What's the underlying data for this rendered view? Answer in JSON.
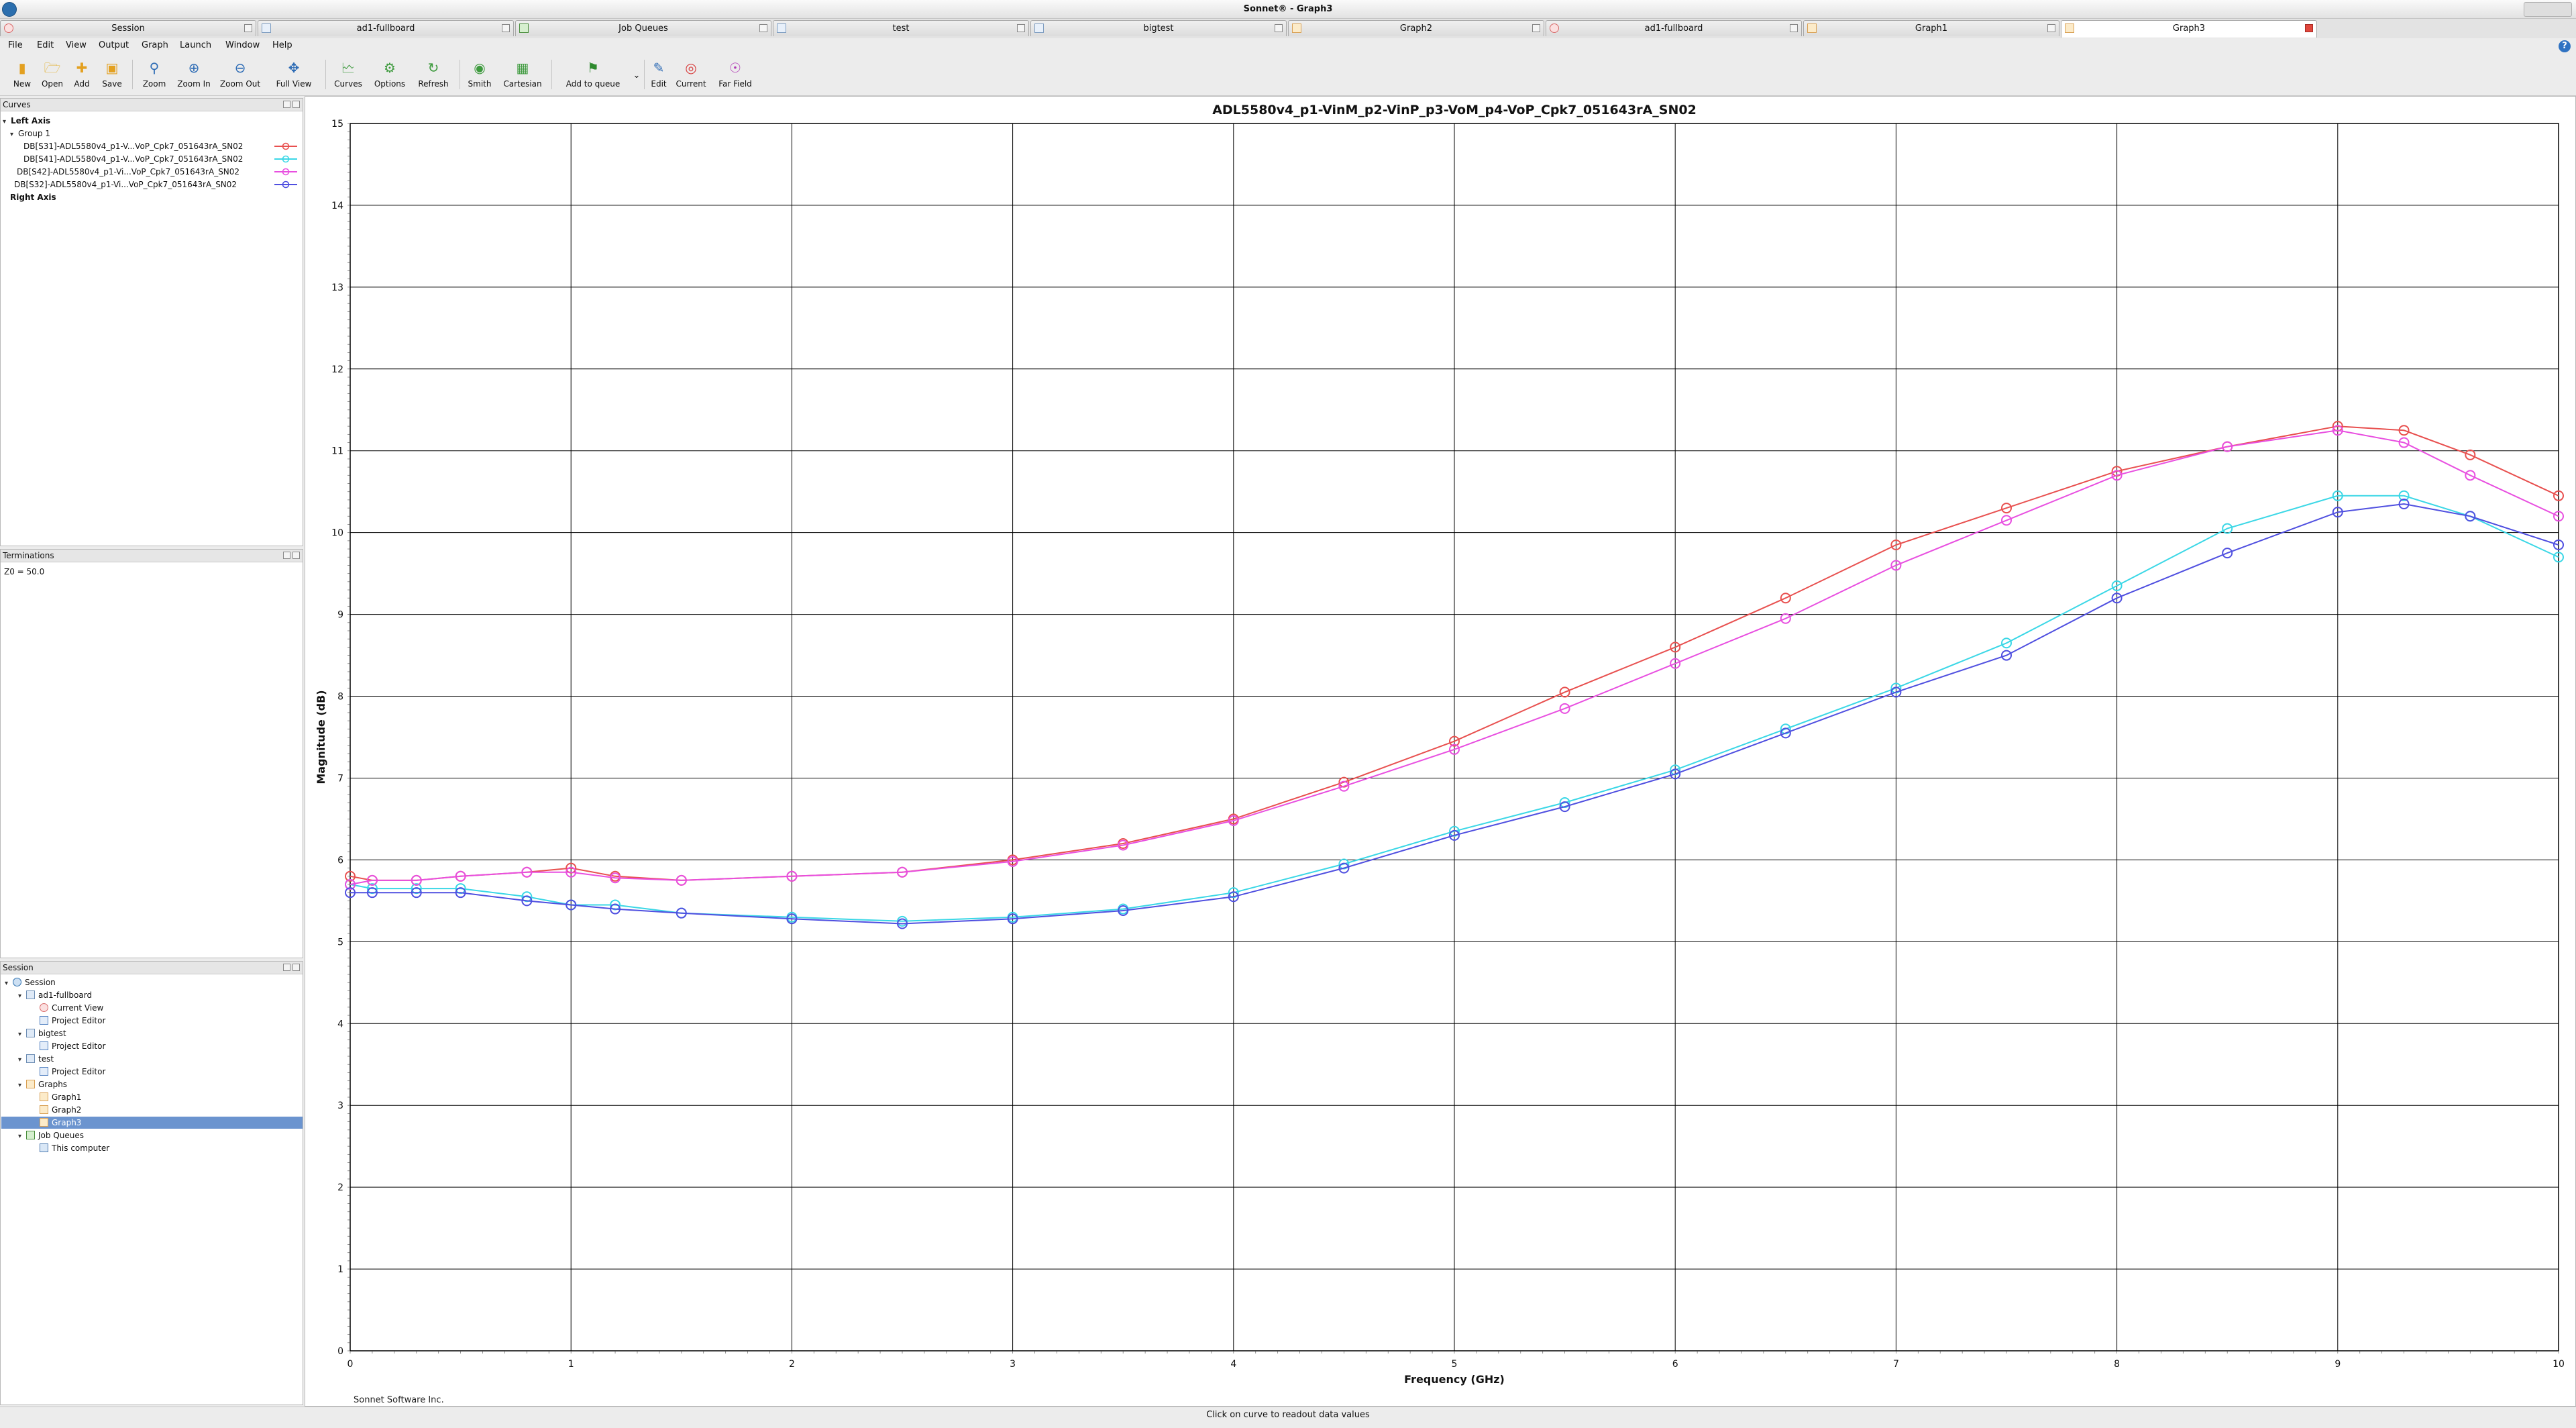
{
  "window": {
    "title": "Sonnet® - Graph3"
  },
  "tabs": [
    {
      "label": "Session",
      "icon": "session-icon",
      "active": false
    },
    {
      "label": "ad1-fullboard",
      "icon": "project-editor-icon",
      "active": false
    },
    {
      "label": "Job Queues",
      "icon": "job-queue-icon",
      "active": false
    },
    {
      "label": "test",
      "icon": "project-editor-icon",
      "active": false
    },
    {
      "label": "bigtest",
      "icon": "project-editor-icon",
      "active": false
    },
    {
      "label": "Graph2",
      "icon": "graph-icon",
      "active": false
    },
    {
      "label": "ad1-fullboard",
      "icon": "current-view-icon",
      "active": false
    },
    {
      "label": "Graph1",
      "icon": "graph-icon",
      "active": false
    },
    {
      "label": "Graph3",
      "icon": "graph-icon",
      "active": true
    }
  ],
  "menu": [
    "File",
    "Edit",
    "View",
    "Output",
    "Graph",
    "Launch",
    "Window",
    "Help"
  ],
  "toolbar": {
    "new": "New",
    "open": "Open",
    "add": "Add",
    "save": "Save",
    "zoom": "Zoom",
    "zoom_in": "Zoom In",
    "zoom_out": "Zoom Out",
    "full_view": "Full View",
    "curves": "Curves",
    "options": "Options",
    "refresh": "Refresh",
    "smith": "Smith",
    "cartesian": "Cartesian",
    "add_to_queue": "Add to queue",
    "edit": "Edit",
    "current": "Current",
    "far_field": "Far Field"
  },
  "curves_panel": {
    "title": "Curves",
    "left_axis": "Left Axis",
    "group": "Group 1",
    "items": [
      {
        "label": "DB[S31]-ADL5580v4_p1-V...VoP_Cpk7_051643rA_SN02",
        "color": "#e8504f"
      },
      {
        "label": "DB[S41]-ADL5580v4_p1-V...VoP_Cpk7_051643rA_SN02",
        "color": "#3ad7e6"
      },
      {
        "label": "DB[S42]-ADL5580v4_p1-Vi...VoP_Cpk7_051643rA_SN02",
        "color": "#e84fe0"
      },
      {
        "label": "DB[S32]-ADL5580v4_p1-Vi...VoP_Cpk7_051643rA_SN02",
        "color": "#4f4fe0"
      }
    ],
    "right_axis": "Right Axis"
  },
  "terminations_panel": {
    "title": "Terminations",
    "value": "Z0 = 50.0"
  },
  "session_panel": {
    "title": "Session",
    "tree": [
      {
        "label": "Session",
        "level": 0,
        "icon": "session-icon",
        "toggle": "expanded"
      },
      {
        "label": "ad1-fullboard",
        "level": 1,
        "icon": "project-icon",
        "toggle": "expanded"
      },
      {
        "label": "Current View",
        "level": 2,
        "icon": "current-view-icon"
      },
      {
        "label": "Project Editor",
        "level": 2,
        "icon": "project-editor-icon"
      },
      {
        "label": "bigtest",
        "level": 1,
        "icon": "project-icon",
        "toggle": "expanded"
      },
      {
        "label": "Project Editor",
        "level": 2,
        "icon": "project-editor-icon"
      },
      {
        "label": "test",
        "level": 1,
        "icon": "project-icon",
        "toggle": "expanded"
      },
      {
        "label": "Project Editor",
        "level": 2,
        "icon": "project-editor-icon"
      },
      {
        "label": "Graphs",
        "level": 1,
        "icon": "graphs-folder-icon",
        "toggle": "expanded"
      },
      {
        "label": "Graph1",
        "level": 2,
        "icon": "graph-icon"
      },
      {
        "label": "Graph2",
        "level": 2,
        "icon": "graph-icon"
      },
      {
        "label": "Graph3",
        "level": 2,
        "icon": "graph-icon",
        "selected": true
      },
      {
        "label": "Job Queues",
        "level": 1,
        "icon": "job-queue-icon",
        "toggle": "expanded"
      },
      {
        "label": "This computer",
        "level": 2,
        "icon": "computer-icon"
      }
    ]
  },
  "footer_text": "Sonnet Software Inc.",
  "status_text": "Click on curve to readout data values",
  "chart_data": {
    "type": "scatter",
    "title": "ADL5580v4_p1-VinM_p2-VinP_p3-VoM_p4-VoP_Cpk7_051643rA_SN02",
    "xlabel": "Frequency (GHz)",
    "ylabel": "Magnitude (dB)",
    "xlim": [
      0,
      10
    ],
    "ylim": [
      0,
      15
    ],
    "xticks": [
      0,
      1,
      2,
      3,
      4,
      5,
      6,
      7,
      8,
      9,
      10
    ],
    "yticks": [
      0,
      1,
      2,
      3,
      4,
      5,
      6,
      7,
      8,
      9,
      10,
      11,
      12,
      13,
      14,
      15
    ],
    "grid": true,
    "marker": "open-circle",
    "series": [
      {
        "name": "DB[S31]-ADL5580v4_p1-V...VoP_Cpk7_051643rA_SN02",
        "color": "#e8504f",
        "x": [
          0,
          0.1,
          0.3,
          0.5,
          0.8,
          1.0,
          1.2,
          1.5,
          2.0,
          2.5,
          3.0,
          3.5,
          4.0,
          4.5,
          5.0,
          5.5,
          6.0,
          6.5,
          7.0,
          7.5,
          8.0,
          8.5,
          9.0,
          9.3,
          9.6,
          10.0
        ],
        "y": [
          5.8,
          5.75,
          5.75,
          5.8,
          5.85,
          5.9,
          5.8,
          5.75,
          5.8,
          5.85,
          6.0,
          6.2,
          6.5,
          6.95,
          7.45,
          8.05,
          8.6,
          9.2,
          9.85,
          10.3,
          10.75,
          11.05,
          11.3,
          11.25,
          10.95,
          10.45
        ]
      },
      {
        "name": "DB[S41]-ADL5580v4_p1-V...VoP_Cpk7_051643rA_SN02",
        "color": "#3ad7e6",
        "x": [
          0,
          0.1,
          0.3,
          0.5,
          0.8,
          1.0,
          1.2,
          1.5,
          2.0,
          2.5,
          3.0,
          3.5,
          4.0,
          4.5,
          5.0,
          5.5,
          6.0,
          6.5,
          7.0,
          7.5,
          8.0,
          8.5,
          9.0,
          9.3,
          9.6,
          10.0
        ],
        "y": [
          5.7,
          5.65,
          5.65,
          5.65,
          5.55,
          5.45,
          5.45,
          5.35,
          5.3,
          5.25,
          5.3,
          5.4,
          5.6,
          5.95,
          6.35,
          6.7,
          7.1,
          7.6,
          8.1,
          8.65,
          9.35,
          10.05,
          10.45,
          10.45,
          10.2,
          9.7
        ]
      },
      {
        "name": "DB[S42]-ADL5580v4_p1-Vi...VoP_Cpk7_051643rA_SN02",
        "color": "#e84fe0",
        "x": [
          0,
          0.1,
          0.3,
          0.5,
          0.8,
          1.0,
          1.2,
          1.5,
          2.0,
          2.5,
          3.0,
          3.5,
          4.0,
          4.5,
          5.0,
          5.5,
          6.0,
          6.5,
          7.0,
          7.5,
          8.0,
          8.5,
          9.0,
          9.3,
          9.6,
          10.0
        ],
        "y": [
          5.7,
          5.75,
          5.75,
          5.8,
          5.85,
          5.85,
          5.78,
          5.75,
          5.8,
          5.85,
          5.98,
          6.18,
          6.48,
          6.9,
          7.35,
          7.85,
          8.4,
          8.95,
          9.6,
          10.15,
          10.7,
          11.05,
          11.25,
          11.1,
          10.7,
          10.2
        ]
      },
      {
        "name": "DB[S32]-ADL5580v4_p1-Vi...VoP_Cpk7_051643rA_SN02",
        "color": "#4f4fe0",
        "x": [
          0,
          0.1,
          0.3,
          0.5,
          0.8,
          1.0,
          1.2,
          1.5,
          2.0,
          2.5,
          3.0,
          3.5,
          4.0,
          4.5,
          5.0,
          5.5,
          6.0,
          6.5,
          7.0,
          7.5,
          8.0,
          8.5,
          9.0,
          9.3,
          9.6,
          10.0
        ],
        "y": [
          5.6,
          5.6,
          5.6,
          5.6,
          5.5,
          5.45,
          5.4,
          5.35,
          5.28,
          5.22,
          5.28,
          5.38,
          5.55,
          5.9,
          6.3,
          6.65,
          7.05,
          7.55,
          8.05,
          8.5,
          9.2,
          9.75,
          10.25,
          10.35,
          10.2,
          9.85
        ]
      }
    ]
  }
}
